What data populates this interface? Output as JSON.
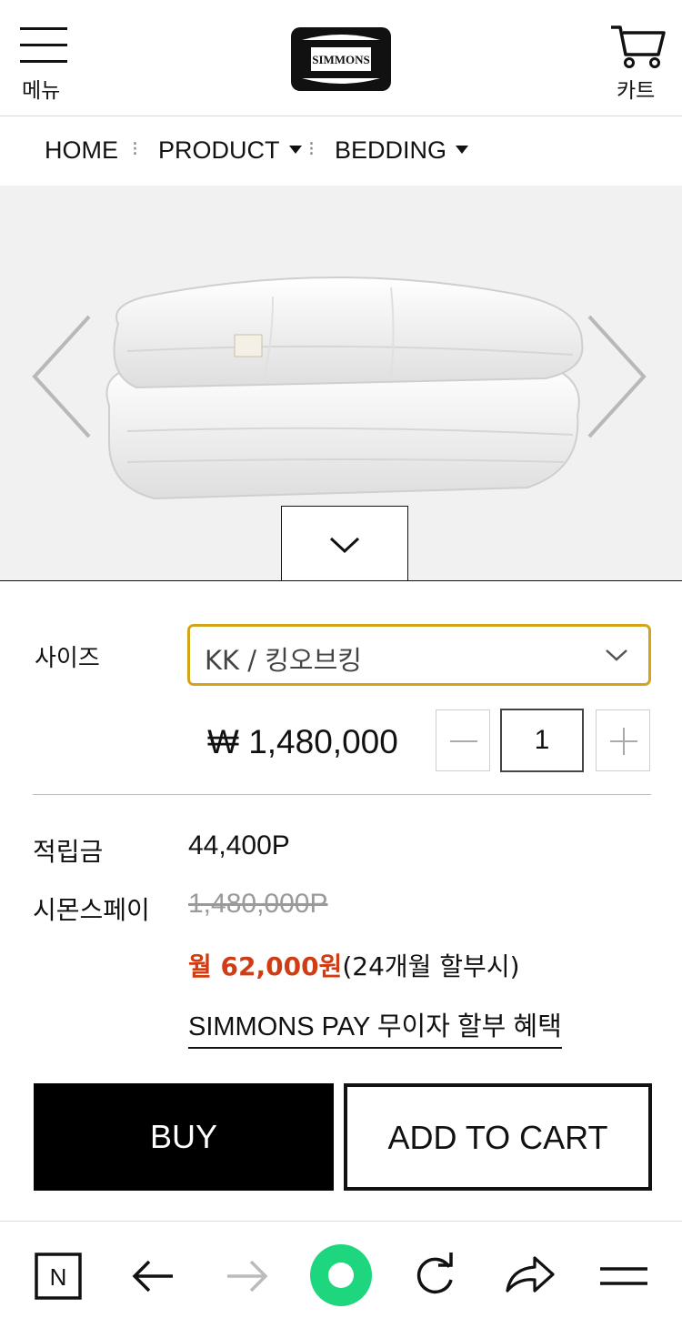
{
  "header": {
    "menu_label": "메뉴",
    "brand": "SIMMONS",
    "cart_label": "카트"
  },
  "breadcrumb": {
    "items": [
      "HOME",
      "PRODUCT",
      "BEDDING"
    ]
  },
  "hero": {
    "image_alt": "goose down comforter"
  },
  "option": {
    "size_label": "사이즈",
    "size_value": "KK / 킹오브킹"
  },
  "price": {
    "amount": "₩ 1,480,000",
    "quantity": "1"
  },
  "points": {
    "label": "적립금",
    "value": "44,400P"
  },
  "simmons_pay": {
    "label": "시몬스페이",
    "value": "1,480,000P",
    "monthly_highlight": "월 62,000원",
    "monthly_suffix": "(24개월 할부시)",
    "link": "SIMMONS PAY 무이자 할부 혜택"
  },
  "actions": {
    "buy": "BUY",
    "add_to_cart": "ADD TO CART"
  },
  "colors": {
    "accent": "#d4a418",
    "sale": "#d03d14",
    "browser_green": "#1ed67e"
  }
}
